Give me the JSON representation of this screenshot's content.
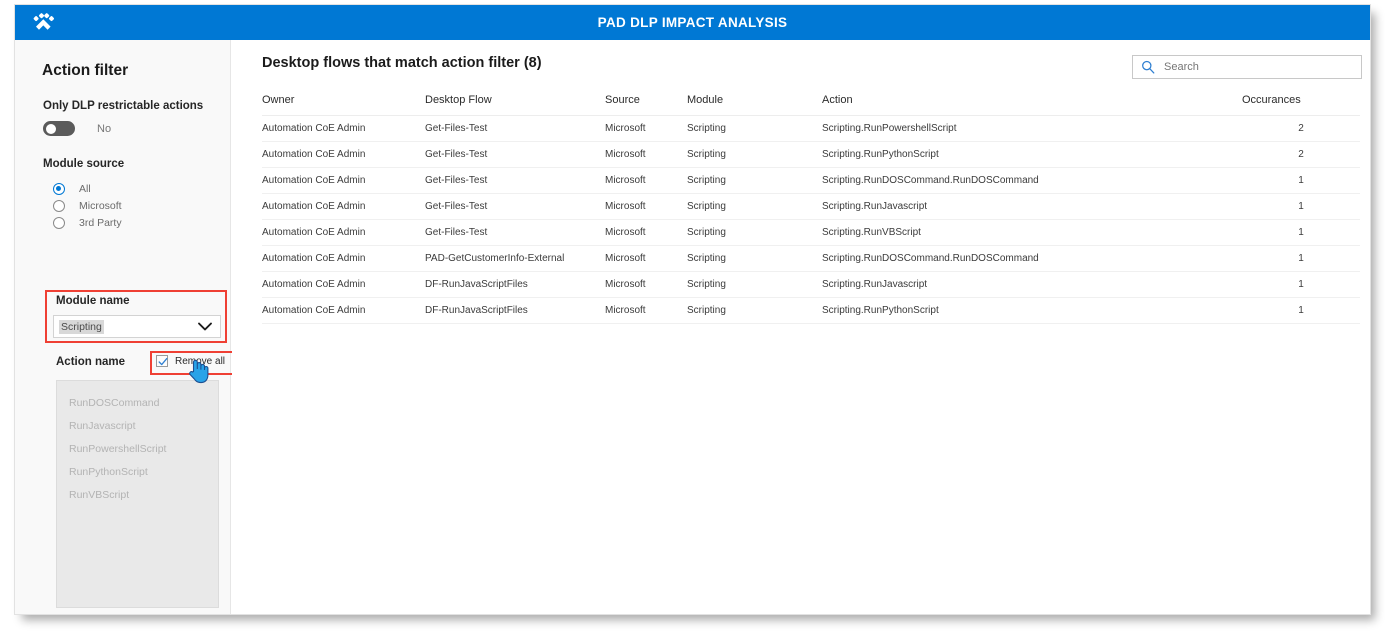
{
  "header": {
    "title": "PAD DLP IMPACT ANALYSIS",
    "logo_icon": "paw-print-icon"
  },
  "sidebar": {
    "title": "Action filter",
    "dlp_toggle": {
      "label": "Only DLP restrictable actions",
      "value": "No",
      "checked": false
    },
    "module_source": {
      "label": "Module source",
      "selected": "All",
      "options": [
        "All",
        "Microsoft",
        "3rd Party"
      ]
    },
    "module_name": {
      "label": "Module name",
      "value": "Scripting",
      "chevron_icon": "chevron-down-icon"
    },
    "action_name": {
      "label": "Action name",
      "remove_all_label": "Remove all",
      "remove_all_checked": true,
      "items": [
        "RunDOSCommand",
        "RunJavascript",
        "RunPowershellScript",
        "RunPythonScript",
        "RunVBScript"
      ]
    }
  },
  "main": {
    "title": "Desktop flows that match action filter (8)",
    "search": {
      "placeholder": "Search",
      "value": "",
      "icon": "search-icon"
    },
    "table": {
      "columns": [
        "Owner",
        "Desktop Flow",
        "Source",
        "Module",
        "Action",
        "Occurances"
      ],
      "rows": [
        [
          "Automation CoE Admin",
          "Get-Files-Test",
          "Microsoft",
          "Scripting",
          "Scripting.RunPowershellScript",
          "2"
        ],
        [
          "Automation CoE Admin",
          "Get-Files-Test",
          "Microsoft",
          "Scripting",
          "Scripting.RunPythonScript",
          "2"
        ],
        [
          "Automation CoE Admin",
          "Get-Files-Test",
          "Microsoft",
          "Scripting",
          "Scripting.RunDOSCommand.RunDOSCommand",
          "1"
        ],
        [
          "Automation CoE Admin",
          "Get-Files-Test",
          "Microsoft",
          "Scripting",
          "Scripting.RunJavascript",
          "1"
        ],
        [
          "Automation CoE Admin",
          "Get-Files-Test",
          "Microsoft",
          "Scripting",
          "Scripting.RunVBScript",
          "1"
        ],
        [
          "Automation CoE Admin",
          "PAD-GetCustomerInfo-External",
          "Microsoft",
          "Scripting",
          "Scripting.RunDOSCommand.RunDOSCommand",
          "1"
        ],
        [
          "Automation CoE Admin",
          "DF-RunJavaScriptFiles",
          "Microsoft",
          "Scripting",
          "Scripting.RunJavascript",
          "1"
        ],
        [
          "Automation CoE Admin",
          "DF-RunJavaScriptFiles",
          "Microsoft",
          "Scripting",
          "Scripting.RunPythonScript",
          "1"
        ]
      ]
    }
  },
  "colors": {
    "accent": "#0078d4",
    "highlight_outline": "#ef4034",
    "link": "#4a6cb5",
    "sidebar_bg": "#f9f9f9"
  }
}
